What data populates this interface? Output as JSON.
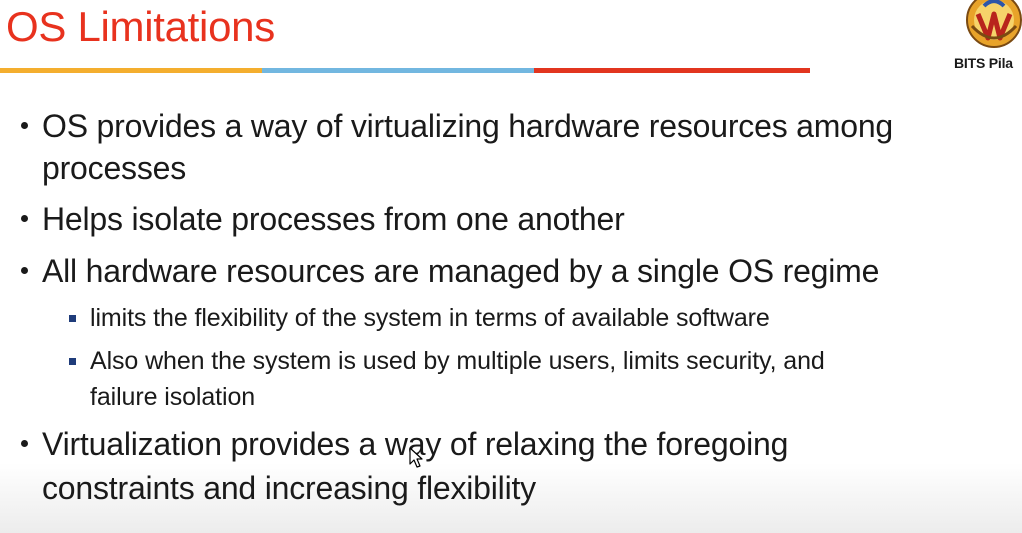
{
  "slide": {
    "title": "OS Limitations",
    "logo_text": "BITS Pila",
    "bullets": [
      {
        "lines": [
          "OS provides a way of virtualizing hardware resources among",
          "processes"
        ]
      },
      {
        "lines": [
          "Helps isolate processes from one another"
        ]
      },
      {
        "lines": [
          "All hardware resources are managed by a single OS regime"
        ]
      },
      {
        "lines": [
          "limits the flexibility of the system in terms of available software"
        ]
      },
      {
        "lines": [
          "Also when the system is used by multiple users, limits security, and",
          "failure isolation"
        ]
      },
      {
        "lines": [
          "Virtualization provides a way of relaxing the foregoing",
          "constraints and increasing flexibility"
        ]
      }
    ]
  },
  "colors": {
    "title": "#e8321e",
    "rule_orange": "#f4ae2e",
    "rule_blue": "#72b7e0",
    "rule_red": "#e2351f",
    "sub_bullet": "#1f3c7a"
  },
  "icons": {
    "logo": "bits-pilani-emblem-icon",
    "cursor": "mouse-pointer-icon"
  }
}
